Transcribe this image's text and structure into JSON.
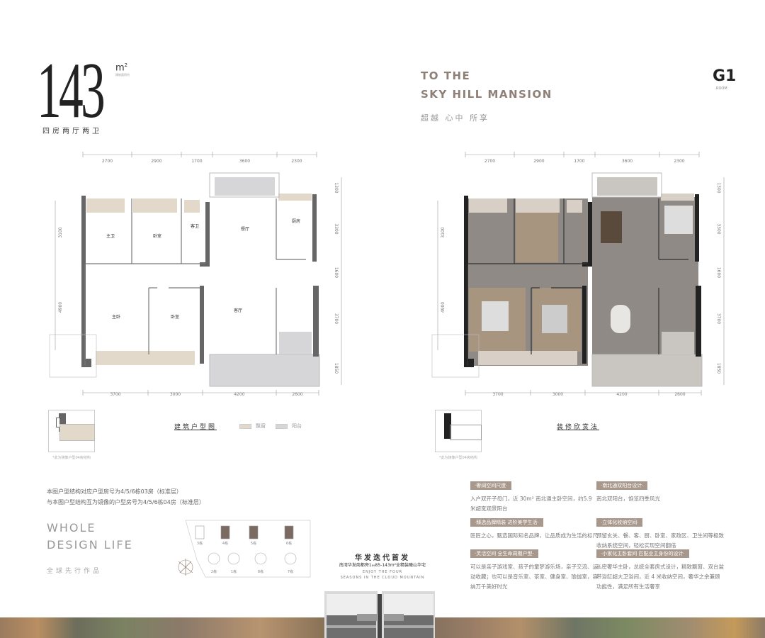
{
  "header": {
    "area": "143",
    "unit": "m",
    "unit_sup": "2",
    "unit_sub": "建筑面积约",
    "layout": "四房两厅两卫",
    "title_line1": "TO THE",
    "title_line2": "SKY HILL MANSION",
    "slogan": "超越  心中  所享",
    "unit_code": "G1",
    "unit_code_label": "ROOM"
  },
  "dims": {
    "top": [
      "2700",
      "2900",
      "1700",
      "3600",
      "2300"
    ],
    "bottom": [
      "3700",
      "3000",
      "4200",
      "2600"
    ],
    "left": [
      "3100",
      "4900"
    ],
    "right": [
      "1300",
      "3300",
      "1600",
      "3700",
      "1850"
    ]
  },
  "rooms": {
    "master_bath": "主卫",
    "bedroom1": "卧室",
    "guest_bath": "客卫",
    "dining": "餐厅",
    "kitchen": "厨房",
    "master_bed": "主卧",
    "bedroom2": "卧室",
    "living": "客厅"
  },
  "plan_left": {
    "caption": "建筑户型图",
    "legend": [
      {
        "label": "飘窗",
        "color": "#e3d9cb"
      },
      {
        "label": "阳台",
        "color": "#d6d6d8"
      }
    ],
    "mirror_note": "*此为镜像户型04房结构"
  },
  "plan_right": {
    "caption": "装修欣赏法",
    "mirror_note": "*此为镜像户型04房结构"
  },
  "notes": [
    "本图户型结构对应户型房号为4/5/6栋03房（标准层）",
    "与本图户型结构互为镜像的户型房号为4/5/6栋04房（标准层）"
  ],
  "tagline": {
    "line1": "WHOLE",
    "line2": "DESIGN LIFE",
    "sub": "全球先行作品"
  },
  "site_map": {
    "buildings_top": [
      "3栋",
      "4栋",
      "5栋",
      "6栋"
    ],
    "buildings_bottom": [
      "2栋",
      "1栋",
      "8栋",
      "7栋"
    ]
  },
  "promo": {
    "title": "华发迭代首发",
    "subtitle": "南湾华发商都旁1₈₉85-143m²全精装瞰山华宅",
    "en1": "ENJOY THE FOUR",
    "en2": "SEASONS IN THE CLOUD MOUNTAIN"
  },
  "features": [
    {
      "tag": "·奢阔空间尺度·",
      "text": "入户双开子母门，近 30m² 南北通主卧空间，约5.9 米超宽观景阳台"
    },
    {
      "tag": "·南北通双阳台设计·",
      "text": "南北双阳台，饱览四季风光"
    },
    {
      "tag": "·臻选品牌精装  进阶美学生活·",
      "text": "匠匠之心，甄选国际知名品牌，让品质成为生活的标尺"
    },
    {
      "tag": "·立体化收纳空间·",
      "text": "预留玄关、餐、客、厨、卧室、家政区、卫生间等极致收纳系统空间，轻松实现空间翻倍"
    },
    {
      "tag": "·灵活空间  全生命周期户型·",
      "text": "可以是亲子游戏室、孩子的童梦游乐场，亲子交流、运动收藏；也可以是音乐室、茶室、健身室、瑜伽室，容纳万千美好时光"
    },
    {
      "tag": "·小家化主卧套间  匹配业主身份的设计·",
      "text": "私密奢华主卧，总统全套房式设计，精致飘窗、双台盆带浴缸超大卫浴间，近 4 米收纳空间，奢华之余兼顾功能性，满足所有生活奢享"
    }
  ]
}
